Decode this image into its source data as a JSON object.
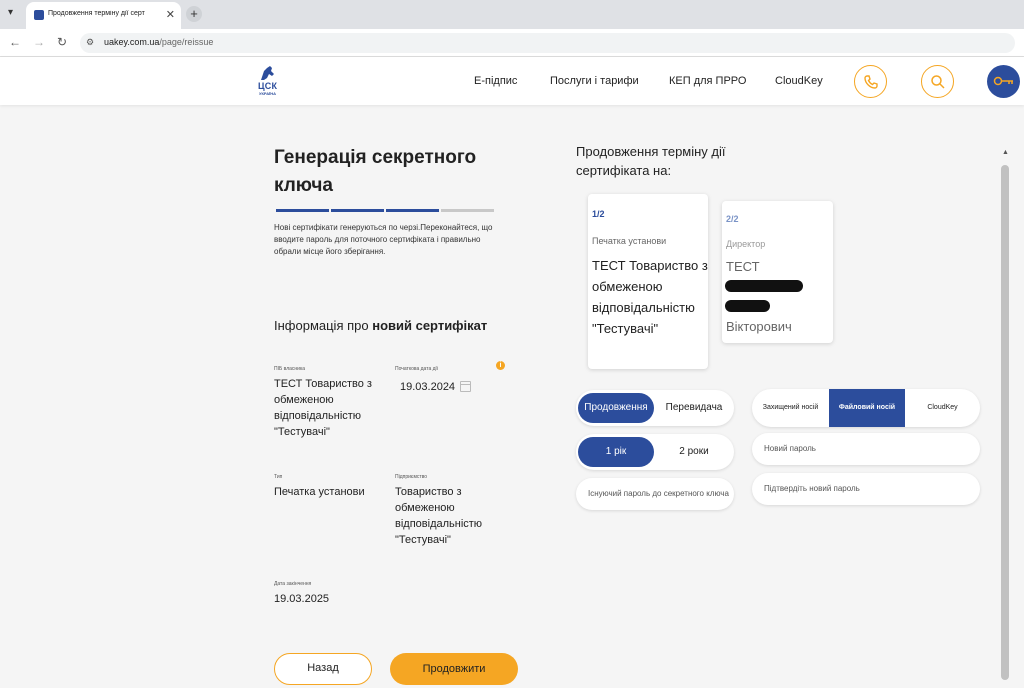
{
  "browser": {
    "tab_title": "Продовження терміну дії серт",
    "url_host": "uakey.com.ua",
    "url_path": "/page/reissue"
  },
  "header": {
    "logo_text": "ЦСК",
    "logo_sub": "УКРАЇНА",
    "nav": [
      "Е-підпис",
      "Послуги і тарифи",
      "КЕП для ПРРО",
      "CloudKey"
    ]
  },
  "left": {
    "title": "Генерація секретного ключа",
    "notice": "Нові сертифікати генеруються по черзі.Переконайтеся, що вводите пароль для поточного сертифіката і правильно обрали місце його зберігання.",
    "section_prefix": "Інформація про ",
    "section_bold": "новий сертифікат",
    "fields": {
      "owner_label": "ПІБ власника",
      "owner_value": "ТЕСТ Товариство з обмеженою відповідальністю \"Тестувачі\"",
      "start_label": "Початкова дата дії",
      "start_value": "19.03.2024",
      "type_label": "Тип",
      "type_value": "Печатка установи",
      "company_label": "Підприємство",
      "company_value": "Товариство з обмеженою відповідальністю \"Тестувачі\"",
      "end_label": "Дата закінчення",
      "end_value": "19.03.2025"
    },
    "back_label": "Назад",
    "next_label": "Продовжити"
  },
  "right": {
    "title": "Продовження терміну дії сертифіката на:",
    "cards": [
      {
        "num": "1/2",
        "role": "Печатка установи",
        "name": "ТЕСТ Товариство з обмеженою відповідальністю \"Тестувачі\""
      },
      {
        "num": "2/2",
        "role": "Директор",
        "name_first": "ТЕСТ",
        "name_last": "Вікторович"
      }
    ],
    "mode_options": [
      "Продовження",
      "Перевидача"
    ],
    "mode_selected": "Продовження",
    "term_options": [
      "1 рік",
      "2 роки"
    ],
    "term_selected": "1 рік",
    "existing_password_placeholder": "Існуючий пароль до секретного ключа",
    "media_options": [
      "Захищений носій",
      "Файловий носій",
      "CloudKey"
    ],
    "media_selected": "Файловий носій",
    "new_password_placeholder": "Новий пароль",
    "confirm_password_placeholder": "Підтвердіть новий пароль"
  },
  "colors": {
    "brand_blue": "#2c4d9c",
    "accent_orange": "#f5a623",
    "progress_inactive": "#c8c8c8"
  }
}
